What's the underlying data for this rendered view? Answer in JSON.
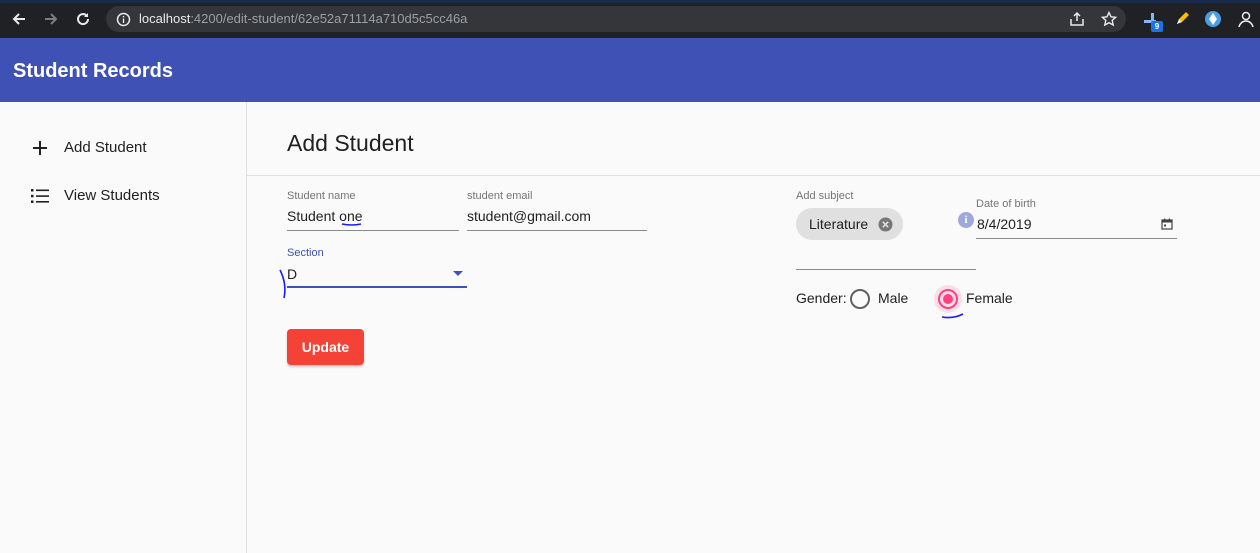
{
  "browser": {
    "url_host": "localhost",
    "url_path": ":4200/edit-student/62e52a71114a710d5c5cc46a",
    "extension_badge": "9"
  },
  "app": {
    "title": "Student Records",
    "primary_color": "#3f51b5",
    "accent_color": "#ff4081",
    "warn_color": "#f44336"
  },
  "sidebar": {
    "items": [
      {
        "label": "Add Student",
        "icon": "plus-icon"
      },
      {
        "label": "View Students",
        "icon": "list-icon"
      }
    ]
  },
  "main": {
    "title": "Add Student",
    "fields": {
      "student_name": {
        "label": "Student name",
        "value": "Student one"
      },
      "student_email": {
        "label": "student email",
        "value": "student@gmail.com"
      },
      "section": {
        "label": "Section",
        "value": "D"
      },
      "subject": {
        "label": "Add subject",
        "chips": [
          "Literature"
        ]
      },
      "dob": {
        "label": "Date of birth",
        "value": "8/4/2019"
      }
    },
    "gender": {
      "label": "Gender:",
      "options": [
        {
          "label": "Male",
          "checked": false
        },
        {
          "label": "Female",
          "checked": true
        }
      ]
    },
    "update_label": "Update"
  }
}
